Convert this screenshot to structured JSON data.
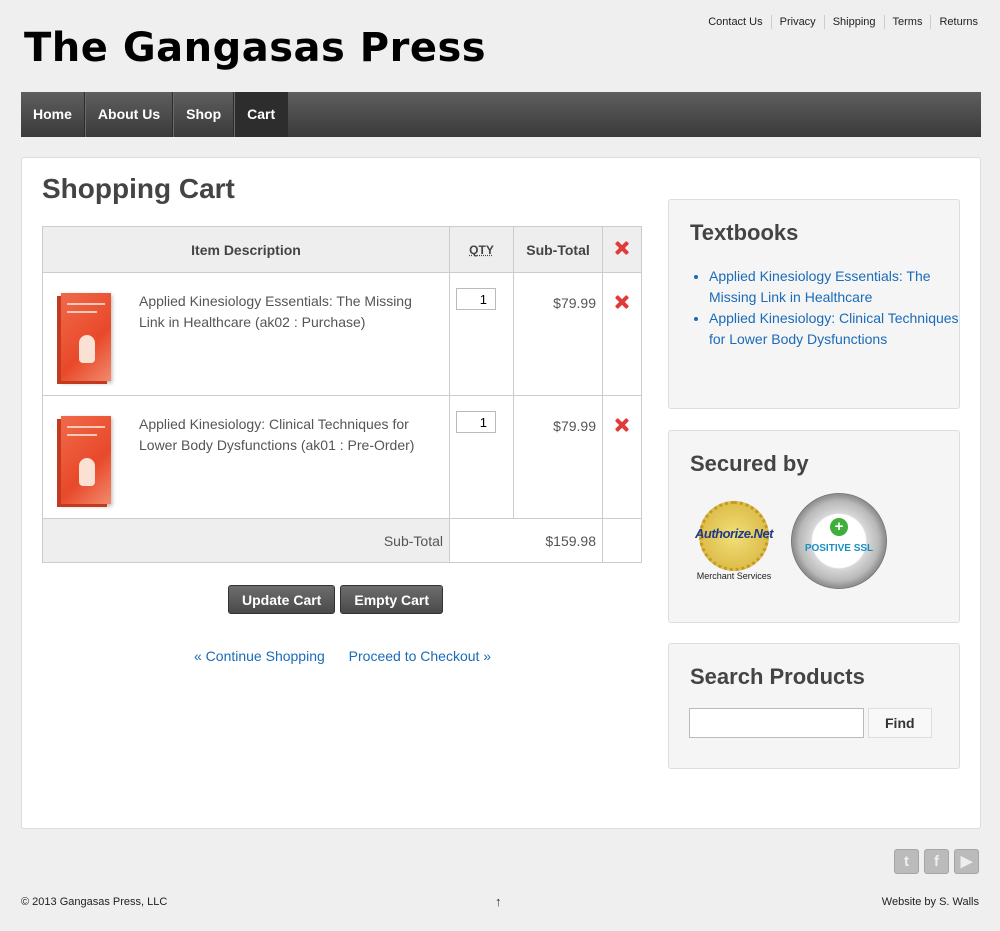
{
  "header": {
    "title": "The Gangasas Press",
    "top_links": [
      "Contact Us",
      "Privacy",
      "Shipping",
      "Terms",
      "Returns"
    ]
  },
  "nav": {
    "items": [
      "Home",
      "About Us",
      "Shop",
      "Cart"
    ],
    "active": "Cart"
  },
  "cart": {
    "title": "Shopping Cart",
    "columns": {
      "description": "Item Description",
      "qty": "QTY",
      "subtotal": "Sub-Total"
    },
    "items": [
      {
        "description": "Applied Kinesiology Essentials: The Missing Link in Healthcare (ak02 : Purchase)",
        "qty": "1",
        "subtotal": "$79.99"
      },
      {
        "description": "Applied Kinesiology: Clinical Techniques for Lower Body Dysfunctions (ak01 : Pre-Order)",
        "qty": "1",
        "subtotal": "$79.99"
      }
    ],
    "total_label": "Sub-Total",
    "total_value": "$159.98",
    "update_button": "Update Cart",
    "empty_button": "Empty Cart",
    "continue_link": "« Continue Shopping",
    "checkout_link": "Proceed to Checkout »"
  },
  "sidebar": {
    "textbooks": {
      "title": "Textbooks",
      "items": [
        "Applied Kinesiology Essentials: The Missing Link in Healthcare",
        "Applied Kinesiology: Clinical Techniques for Lower Body Dysfunctions"
      ]
    },
    "secured": {
      "title": "Secured by",
      "authorize_name": "Authorize.Net",
      "authorize_sub": "Merchant Services",
      "ssl_text": "POSITIVE SSL"
    },
    "search": {
      "title": "Search Products",
      "placeholder": "",
      "button": "Find"
    }
  },
  "social": {
    "icons": [
      "twitter-icon",
      "facebook-icon",
      "youtube-icon"
    ]
  },
  "footer": {
    "copyright": "© 2013 Gangasas Press, LLC",
    "top_arrow": "↑",
    "credit": "Website by S. Walls"
  }
}
